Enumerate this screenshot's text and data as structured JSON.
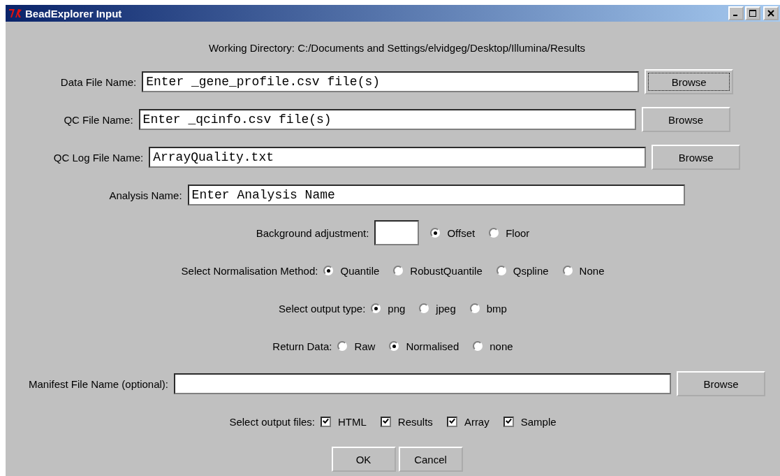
{
  "window": {
    "title": "BeadExplorer Input"
  },
  "working_directory": "Working Directory: C:/Documents and Settings/elvidgeg/Desktop/Illumina/Results",
  "rows": [
    {
      "kind": "file",
      "label": "Data File Name:",
      "value": "Enter _gene_profile.csv file(s)",
      "browse": {
        "label": "Browse",
        "focused": true
      }
    },
    {
      "kind": "file",
      "label": "QC File Name:",
      "value": "Enter _qcinfo.csv file(s)",
      "browse": {
        "label": "Browse",
        "focused": false
      }
    },
    {
      "kind": "file",
      "label": "QC Log File Name:",
      "value": "ArrayQuality.txt",
      "browse": {
        "label": "Browse",
        "focused": false
      }
    },
    {
      "kind": "text",
      "label": "Analysis Name:",
      "value": "Enter Analysis Name"
    },
    {
      "kind": "field_radio",
      "label": "Background adjustment:",
      "options": [
        {
          "label": "Offset",
          "selected": true
        },
        {
          "label": "Floor",
          "selected": false
        }
      ]
    },
    {
      "kind": "radio",
      "label": "Select Normalisation Method:",
      "options": [
        {
          "label": "Quantile",
          "selected": true
        },
        {
          "label": "RobustQuantile",
          "selected": false
        },
        {
          "label": "Qspline",
          "selected": false
        },
        {
          "label": "None",
          "selected": false
        }
      ]
    },
    {
      "kind": "radio",
      "label": "Select output type:",
      "options": [
        {
          "label": "png",
          "selected": true
        },
        {
          "label": "jpeg",
          "selected": false
        },
        {
          "label": "bmp",
          "selected": false
        }
      ]
    },
    {
      "kind": "radio",
      "label": "Return Data:",
      "options": [
        {
          "label": "Raw",
          "selected": false
        },
        {
          "label": "Normalised",
          "selected": true
        },
        {
          "label": "none",
          "selected": false
        }
      ]
    },
    {
      "kind": "file",
      "label": "Manifest File Name (optional):",
      "browse": {
        "label": "Browse",
        "focused": false
      }
    },
    {
      "kind": "check",
      "label": "Select output files:",
      "options": [
        {
          "label": "HTML",
          "checked": true
        },
        {
          "label": "Results",
          "checked": true
        },
        {
          "label": "Array",
          "checked": true
        },
        {
          "label": "Sample",
          "checked": true
        }
      ]
    }
  ],
  "buttons": [
    "OK",
    "Cancel"
  ]
}
